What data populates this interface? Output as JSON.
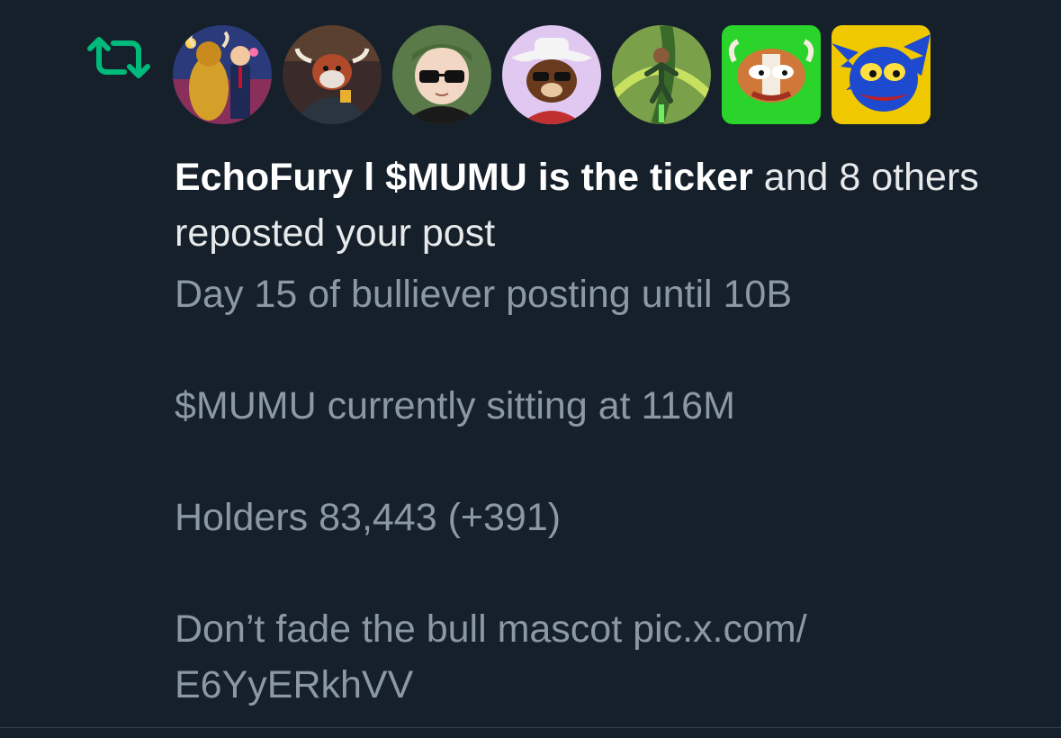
{
  "notification": {
    "type_icon": "repost-icon",
    "accent_color": "#00ba7c",
    "avatars": [
      {
        "icon": "avatar-gold-bull-icon"
      },
      {
        "icon": "avatar-bull-suit-icon"
      },
      {
        "icon": "avatar-sunglasses-icon"
      },
      {
        "icon": "avatar-cowboy-dog-icon"
      },
      {
        "icon": "avatar-green-hero-icon"
      },
      {
        "icon": "avatar-pepe-bull-icon"
      },
      {
        "icon": "avatar-sonic-pepe-icon"
      }
    ],
    "headline": {
      "user_name": "EchoFury l $MUMU is the ticker",
      "suffix": " and 8 others reposted your post"
    },
    "post": {
      "line1": "Day 15 of bulliever posting until 10B",
      "line2": "$MUMU currently sitting at 116M",
      "line3": "Holders 83,443 (+391)",
      "line4_text": "Don’t fade the bull mascot ",
      "line4_link": "pic.x.com/ E6YyERkhVV"
    }
  }
}
